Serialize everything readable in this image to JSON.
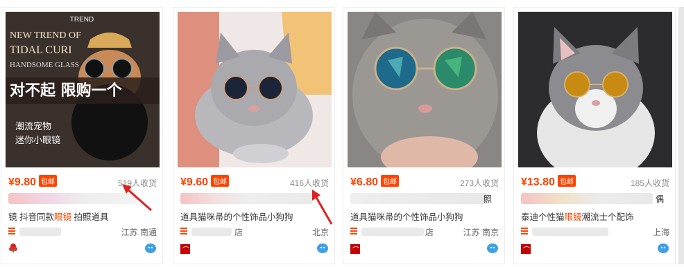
{
  "products": [
    {
      "price": "¥9.80",
      "free_shipping": "包邮",
      "sold": "519人收货",
      "title_prefix": "镜 抖音同款",
      "title_highlight": "眼镜",
      "title_suffix": " 拍照道具",
      "shop_tail": "",
      "location": "江苏 南通",
      "image_text": {
        "trend": "TREND",
        "line1": "NEW TREND OF",
        "line2": "TIDAL CURI",
        "line3": "HANDSOME GLASS",
        "banner": "对不起  限购一个",
        "sub1": "潮流宠物",
        "sub2": "迷你小眼镜"
      }
    },
    {
      "price": "¥9.60",
      "free_shipping": "包邮",
      "sold": "416人收货",
      "title_prefix": "道具猫咪帚的个性饰品小狗狗",
      "title_highlight": "",
      "title_suffix": "",
      "shop_tail": "店",
      "location": "北京"
    },
    {
      "price": "¥6.80",
      "free_shipping": "包邮",
      "sold": "273人收货",
      "title_prefix": "道具猫咪帚的个性饰品小狗狗",
      "title_highlight": "",
      "title_suffix": "",
      "shop_tail": "店",
      "location": "江苏 南京",
      "blur_tail": "照"
    },
    {
      "price": "¥13.80",
      "free_shipping": "包邮",
      "sold": "185人收货",
      "title_prefix": "泰迪个性猫",
      "title_highlight": "眼镜",
      "title_suffix": "潮流士个配饰",
      "shop_tail": "",
      "location": "上海",
      "blur_tail": "偶"
    }
  ],
  "colors": {
    "accent": "#ff4400",
    "tmall_red": "#c40000",
    "arrow_red": "#e02020"
  }
}
